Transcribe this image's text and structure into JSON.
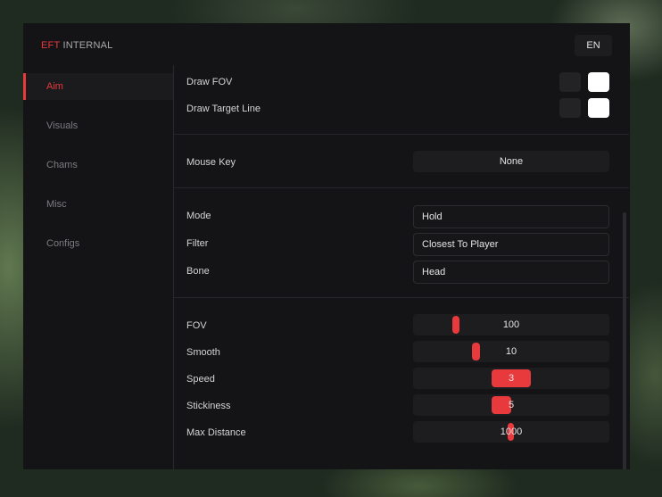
{
  "header": {
    "brand_accent": "EFT",
    "brand_rest": "INTERNAL",
    "language": "EN"
  },
  "sidebar": {
    "items": [
      {
        "label": "Aim",
        "active": true
      },
      {
        "label": "Visuals",
        "active": false
      },
      {
        "label": "Chams",
        "active": false
      },
      {
        "label": "Misc",
        "active": false
      },
      {
        "label": "Configs",
        "active": false
      }
    ]
  },
  "draw": {
    "fov_label": "Draw FOV",
    "target_line_label": "Draw Target Line"
  },
  "mouse_key": {
    "label": "Mouse Key",
    "value": "None"
  },
  "selects": {
    "mode": {
      "label": "Mode",
      "value": "Hold"
    },
    "filter": {
      "label": "Filter",
      "value": "Closest To Player"
    },
    "bone": {
      "label": "Bone",
      "value": "Head"
    }
  },
  "sliders": {
    "fov": {
      "label": "FOV",
      "value": "100",
      "fill_start": 0.2,
      "fill_end": 0.235
    },
    "smooth": {
      "label": "Smooth",
      "value": "10",
      "fill_start": 0.3,
      "fill_end": 0.34
    },
    "speed": {
      "label": "Speed",
      "value": "3",
      "fill_start": 0.4,
      "fill_end": 0.6
    },
    "stickiness": {
      "label": "Stickiness",
      "value": "5",
      "fill_start": 0.4,
      "fill_end": 0.5
    },
    "max_distance": {
      "label": "Max Distance",
      "value": "1000",
      "fill_start": 0.48,
      "fill_end": 0.515
    }
  },
  "colors": {
    "accent": "#e8393d",
    "window": "#141416",
    "swatch_primary": "#ffffff",
    "swatch_secondary": "#232326"
  }
}
